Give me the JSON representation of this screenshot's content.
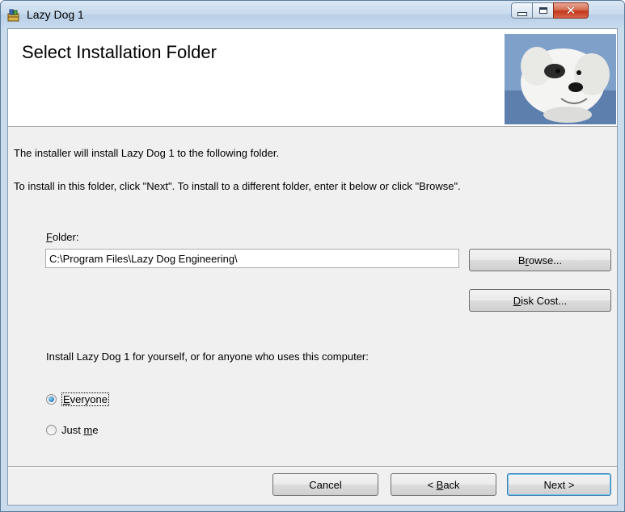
{
  "window": {
    "title": "Lazy Dog 1",
    "icons": {
      "app": "installer-icon",
      "minimize": "minimize-icon",
      "maximize": "maximize-icon",
      "close": "close-icon"
    }
  },
  "banner": {
    "title": "Select Installation Folder",
    "image": "dog-painting-image"
  },
  "body": {
    "line1": "The installer will install Lazy Dog 1 to the following folder.",
    "line2": "To install in this folder, click \"Next\". To install to a different folder, enter it below or click \"Browse\"."
  },
  "folder": {
    "label_mnemonic": "F",
    "label_rest": "older:",
    "value": "C:\\Program Files\\Lazy Dog Engineering\\"
  },
  "buttons": {
    "browse": {
      "pre": "B",
      "mnemonic": "r",
      "post": "owse..."
    },
    "disk_cost": {
      "mnemonic": "D",
      "post": "isk Cost..."
    },
    "cancel": "Cancel",
    "back": {
      "pre": "< ",
      "mnemonic": "B",
      "post": "ack"
    },
    "next": "Next >"
  },
  "install_for": {
    "prompt": "Install Lazy Dog 1 for yourself, or for anyone who uses this computer:",
    "options": [
      {
        "mnemonic": "E",
        "rest": "veryone",
        "selected": true
      },
      {
        "pre": "Just ",
        "mnemonic": "m",
        "rest": "e",
        "selected": false
      }
    ]
  },
  "colors": {
    "titlebar": "#c6d9ec",
    "close_button": "#c4361b",
    "dialog_bg": "#f0f0f0",
    "default_button_border": "#3c7fb1"
  }
}
